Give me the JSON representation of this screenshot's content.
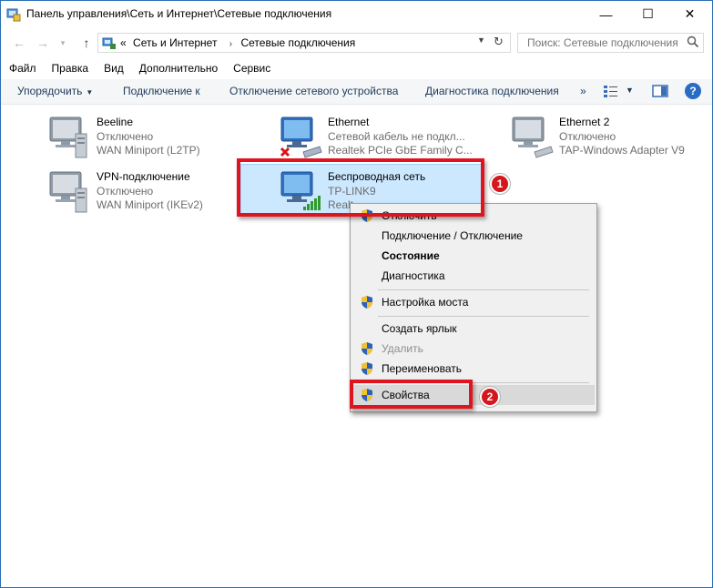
{
  "window": {
    "title": "Панель управления\\Сеть и Интернет\\Сетевые подключения",
    "minimize": "—",
    "maximize": "☐",
    "close": "✕"
  },
  "address": {
    "prefix": "«",
    "crumbs": [
      "Сеть и Интернет",
      "Сетевые подключения"
    ],
    "separator": "›",
    "search_placeholder": "Поиск: Сетевые подключения"
  },
  "menu": [
    "Файл",
    "Правка",
    "Вид",
    "Дополнительно",
    "Сервис"
  ],
  "commands": {
    "organize": "Упорядочить",
    "connect": "Подключение к",
    "disable": "Отключение сетевого устройства",
    "diagnose": "Диагностика подключения",
    "more": "»",
    "help": "?"
  },
  "connections": [
    {
      "name": "Beeline",
      "status": "Отключено",
      "device": "WAN Miniport (L2TP)"
    },
    {
      "name": "Ethernet",
      "status": "Сетевой кабель не подкл...",
      "device": "Realtek PCIe GbE Family C..."
    },
    {
      "name": "Ethernet 2",
      "status": "Отключено",
      "device": "TAP-Windows Adapter V9"
    },
    {
      "name": "VPN-подключение",
      "status": "Отключено",
      "device": "WAN Miniport (IKEv2)"
    },
    {
      "name": "Беспроводная сеть",
      "status": "TP-LINK9",
      "device": "Realt"
    }
  ],
  "context_menu": {
    "items": [
      {
        "label": "Отключить",
        "shield": true,
        "style": "normal"
      },
      {
        "label": "Подключение / Отключение",
        "shield": false,
        "style": "normal"
      },
      {
        "label": "Состояние",
        "shield": false,
        "style": "bold"
      },
      {
        "label": "Диагностика",
        "shield": false,
        "style": "normal"
      },
      {
        "label": "Настройка моста",
        "shield": true,
        "style": "normal"
      },
      {
        "label": "Создать ярлык",
        "shield": false,
        "style": "normal"
      },
      {
        "label": "Удалить",
        "shield": true,
        "style": "disabled"
      },
      {
        "label": "Переименовать",
        "shield": true,
        "style": "normal"
      },
      {
        "label": "Свойства",
        "shield": true,
        "style": "hover"
      }
    ]
  },
  "annotations": {
    "step1": "1",
    "step2": "2"
  },
  "colors": {
    "accent": "#2a6bc5",
    "highlight": "#cce8ff",
    "annotation_red": "#e0141e"
  }
}
